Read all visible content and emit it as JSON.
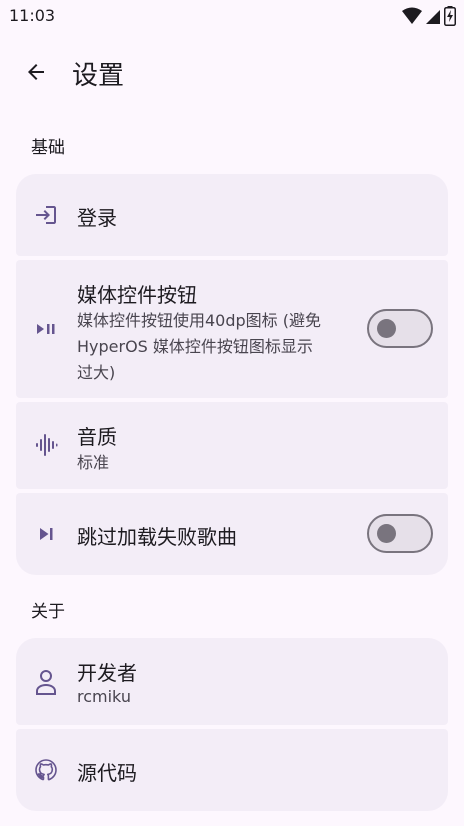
{
  "status_bar": {
    "time": "11:03",
    "icons": [
      "wifi-icon",
      "signal-icon",
      "battery-charging-icon"
    ]
  },
  "app_bar": {
    "back_icon": "arrow-back-icon",
    "title": "设置"
  },
  "sections": {
    "basic": {
      "title": "基础",
      "items": {
        "login": {
          "icon": "login-icon",
          "title": "登录"
        },
        "media_controls": {
          "icon": "play-pause-icon",
          "title": "媒体控件按钮",
          "subtitle_line1": "媒体控件按钮使用40dp图标 (避免",
          "subtitle_line2": "HyperOS 媒体控件按钮图标显示",
          "subtitle_line3": "过大)",
          "toggle_on": false
        },
        "audio_quality": {
          "icon": "graphic-eq-icon",
          "title": "音质",
          "value": "标准"
        },
        "skip_failed": {
          "icon": "skip-next-icon",
          "title": "跳过加载失败歌曲",
          "toggle_on": false
        }
      }
    },
    "about": {
      "title": "关于",
      "items": {
        "developer": {
          "icon": "person-icon",
          "title": "开发者",
          "value": "rcmiku"
        },
        "source_code": {
          "icon": "github-icon",
          "title": "源代码"
        }
      }
    }
  },
  "colors": {
    "background": "#FDF7FE",
    "card": "#F3EDF7",
    "accent": "#65558F",
    "on_surface": "#1D1B20",
    "on_surface_variant": "#49454F",
    "outline": "#79747E"
  }
}
